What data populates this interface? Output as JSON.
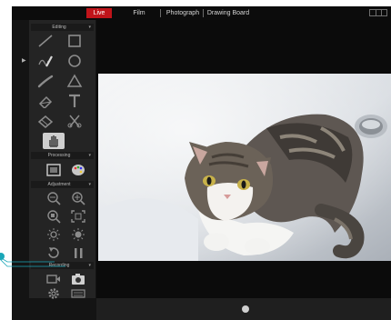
{
  "topbar": {
    "tabs": [
      {
        "label": "Live",
        "active": true
      },
      {
        "label": "Film",
        "active": false
      },
      {
        "label": "Photograph",
        "active": false
      },
      {
        "label": "Drawing Board",
        "active": false
      }
    ]
  },
  "toolbox": {
    "sections": {
      "editing": "Editing",
      "processing": "Processing",
      "adjustment": "Adjustment",
      "recording": "Recording"
    },
    "tools": {
      "line": "line-icon",
      "rectangle": "rectangle-icon",
      "pen": "pen-icon",
      "circle": "circle-icon",
      "brush": "brush-icon",
      "triangle": "triangle-icon",
      "eraser": "eraser-icon",
      "text": "text-icon",
      "stamp": "stamp-icon",
      "scissors": "scissors-icon",
      "hand": "hand-icon",
      "image": "image-icon",
      "palette": "palette-icon",
      "zoom_out": "zoom-out-icon",
      "zoom_in": "zoom-in-icon",
      "zoom_fit": "zoom-fit-icon",
      "fullscreen": "fullscreen-icon",
      "brightness_down": "brightness-down-icon",
      "brightness_up": "brightness-up-icon",
      "rotate": "rotate-icon",
      "pause": "pause-icon",
      "video": "video-icon",
      "camera": "camera-icon",
      "settings": "gear-icon",
      "keyboard": "keyboard-icon"
    }
  },
  "colors": {
    "active_tab": "#c0141a",
    "callout": "#1aa7b8",
    "panel": "#242424",
    "viewer": "#0b0b0b"
  }
}
